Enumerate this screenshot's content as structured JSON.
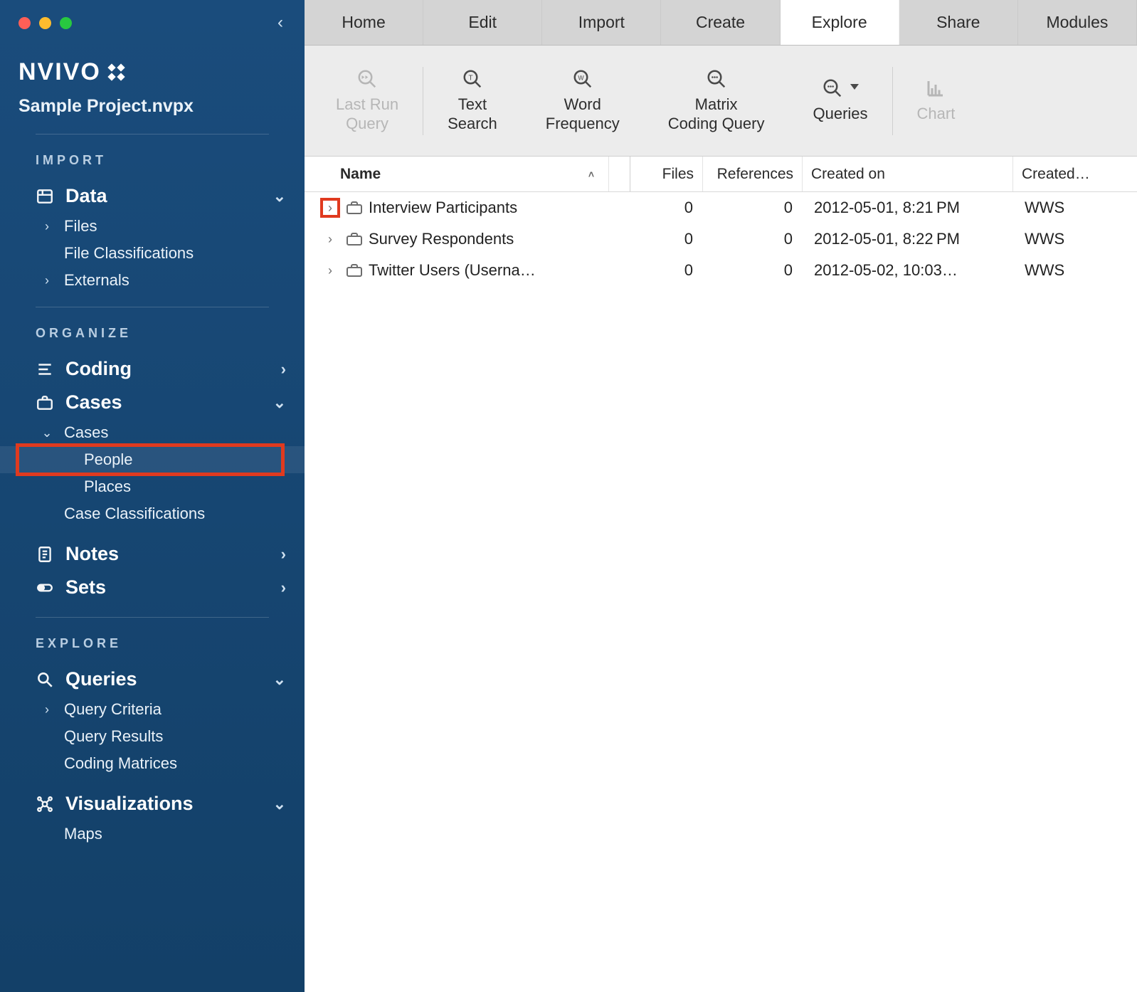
{
  "brand": {
    "name": "NVIVO"
  },
  "project_name": "Sample Project.nvpx",
  "sidebar": {
    "sections": {
      "import": {
        "label": "IMPORT",
        "data": {
          "label": "Data",
          "expanded": true,
          "children": [
            {
              "label": "Files",
              "has_children": true
            },
            {
              "label": "File Classifications",
              "has_children": false
            },
            {
              "label": "Externals",
              "has_children": true
            }
          ]
        }
      },
      "organize": {
        "label": "ORGANIZE",
        "coding": {
          "label": "Coding"
        },
        "cases": {
          "label": "Cases",
          "expanded": true,
          "children": [
            {
              "label": "Cases",
              "has_children": true,
              "children": [
                {
                  "label": "People",
                  "selected": true
                },
                {
                  "label": "Places"
                }
              ]
            },
            {
              "label": "Case Classifications",
              "has_children": false
            }
          ]
        },
        "notes": {
          "label": "Notes"
        },
        "sets": {
          "label": "Sets"
        }
      },
      "explore": {
        "label": "EXPLORE",
        "queries": {
          "label": "Queries",
          "expanded": true,
          "children": [
            {
              "label": "Query Criteria",
              "has_children": true
            },
            {
              "label": "Query Results",
              "has_children": false
            },
            {
              "label": "Coding Matrices",
              "has_children": false
            }
          ]
        },
        "visualizations": {
          "label": "Visualizations",
          "expanded": true,
          "children": [
            {
              "label": "Maps",
              "has_children": false
            }
          ]
        }
      }
    }
  },
  "tabs": [
    "Home",
    "Edit",
    "Import",
    "Create",
    "Explore",
    "Share",
    "Modules"
  ],
  "active_tab": "Explore",
  "ribbon": {
    "last_run": {
      "line1": "Last Run",
      "line2": "Query"
    },
    "text_search": {
      "line1": "Text",
      "line2": "Search"
    },
    "word_freq": {
      "line1": "Word",
      "line2": "Frequency"
    },
    "matrix": {
      "line1": "Matrix",
      "line2": "Coding Query"
    },
    "queries": {
      "label": "Queries"
    },
    "chart": {
      "label": "Chart"
    }
  },
  "columns": {
    "name": "Name",
    "files": "Files",
    "refs": "References",
    "created": "Created on",
    "by": "Created…"
  },
  "rows": [
    {
      "name": "Interview Participants",
      "files": "0",
      "refs": "0",
      "created": "2012-05-01, 8:21 PM",
      "by": "WWS",
      "highlight_expander": true
    },
    {
      "name": "Survey Respondents",
      "files": "0",
      "refs": "0",
      "created": "2012-05-01, 8:22 PM",
      "by": "WWS"
    },
    {
      "name": "Twitter Users (Userna…",
      "files": "0",
      "refs": "0",
      "created": "2012-05-02, 10:03…",
      "by": "WWS"
    }
  ]
}
